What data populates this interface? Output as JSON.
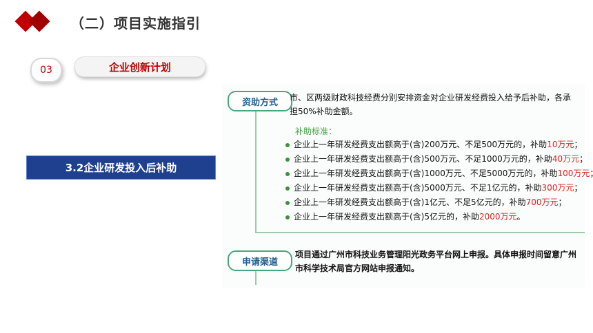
{
  "header": {
    "title": "（二）项目实施指引"
  },
  "step": {
    "number": "03",
    "title": "企业创新计划"
  },
  "section_badge": "3.2企业研发投入后补助",
  "support": {
    "label": "资助方式",
    "description": "市、区两级财政科技经费分别安排资金对企业研发经费投入给予后补助，各承担50%补助金额。",
    "standard_title": "补助标准：",
    "items": [
      {
        "text": "企业上一年研发经费支出额高于(含)200万元、不足500万元的，补助",
        "amount": "10万元",
        "end": "；"
      },
      {
        "text": "企业上一年研发经费支出额高于(含)500万元、不足1000万元的，补助",
        "amount": "40万元",
        "end": "；"
      },
      {
        "text": "企业上一年研发经费支出额高于(含)1000万元、不足5000万元的，补助",
        "amount": "100万元",
        "end": "；"
      },
      {
        "text": "企业上一年研发经费支出额高于(含)5000万元、不足1亿元的，补助",
        "amount": "300万元",
        "end": "；"
      },
      {
        "text": "企业上一年研发经费支出额高于(含)1亿元、不足5亿元的，补助",
        "amount": "700万元",
        "end": "；"
      },
      {
        "text": "企业上一年研发经费支出额高于(含)5亿元的，补助",
        "amount": "2000万元",
        "end": "。"
      }
    ]
  },
  "channel": {
    "label": "申请渠道",
    "description": "项目通过广州市科技业务管理阳光政务平台网上申报。具体申报时间留意广州市科学技术局官方网站申报通知。"
  },
  "colors": {
    "brand_red": "#c00000",
    "badge_blue": "#1f3f8f",
    "accent_green": "#48a77a",
    "amount_red": "#e02020"
  }
}
